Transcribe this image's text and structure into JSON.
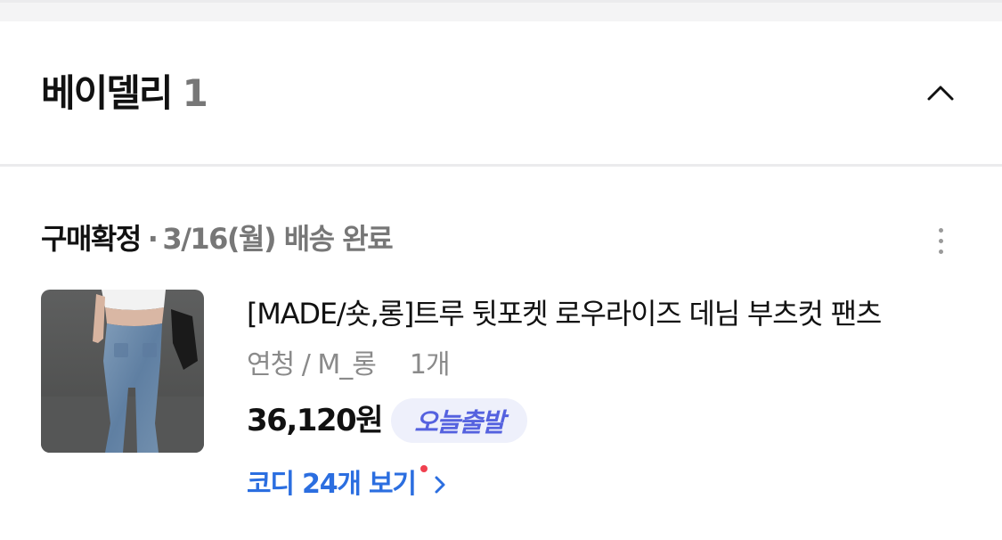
{
  "store": {
    "name": "베이델리",
    "count": "1"
  },
  "order": {
    "status": "구매확정",
    "separator": "·",
    "delivery": "3/16(월) 배송 완료"
  },
  "product": {
    "name": "[MADE/숏,롱]트루 뒷포켓 로우라이즈 데님 부츠컷 팬츠",
    "option": "연청 / M_롱",
    "quantity": "1개",
    "price": "36,120원",
    "badge": "오늘출발"
  },
  "coordi": {
    "label": "코디 24개 보기"
  },
  "icons": {
    "collapse": "chevron-up-icon",
    "more": "more-vertical-icon",
    "link": "chevron-right-icon"
  },
  "colors": {
    "accent_blue": "#2b6ee0",
    "badge_text": "#5562df",
    "badge_bg": "#eef0fb",
    "notification_dot": "#f0404f"
  }
}
